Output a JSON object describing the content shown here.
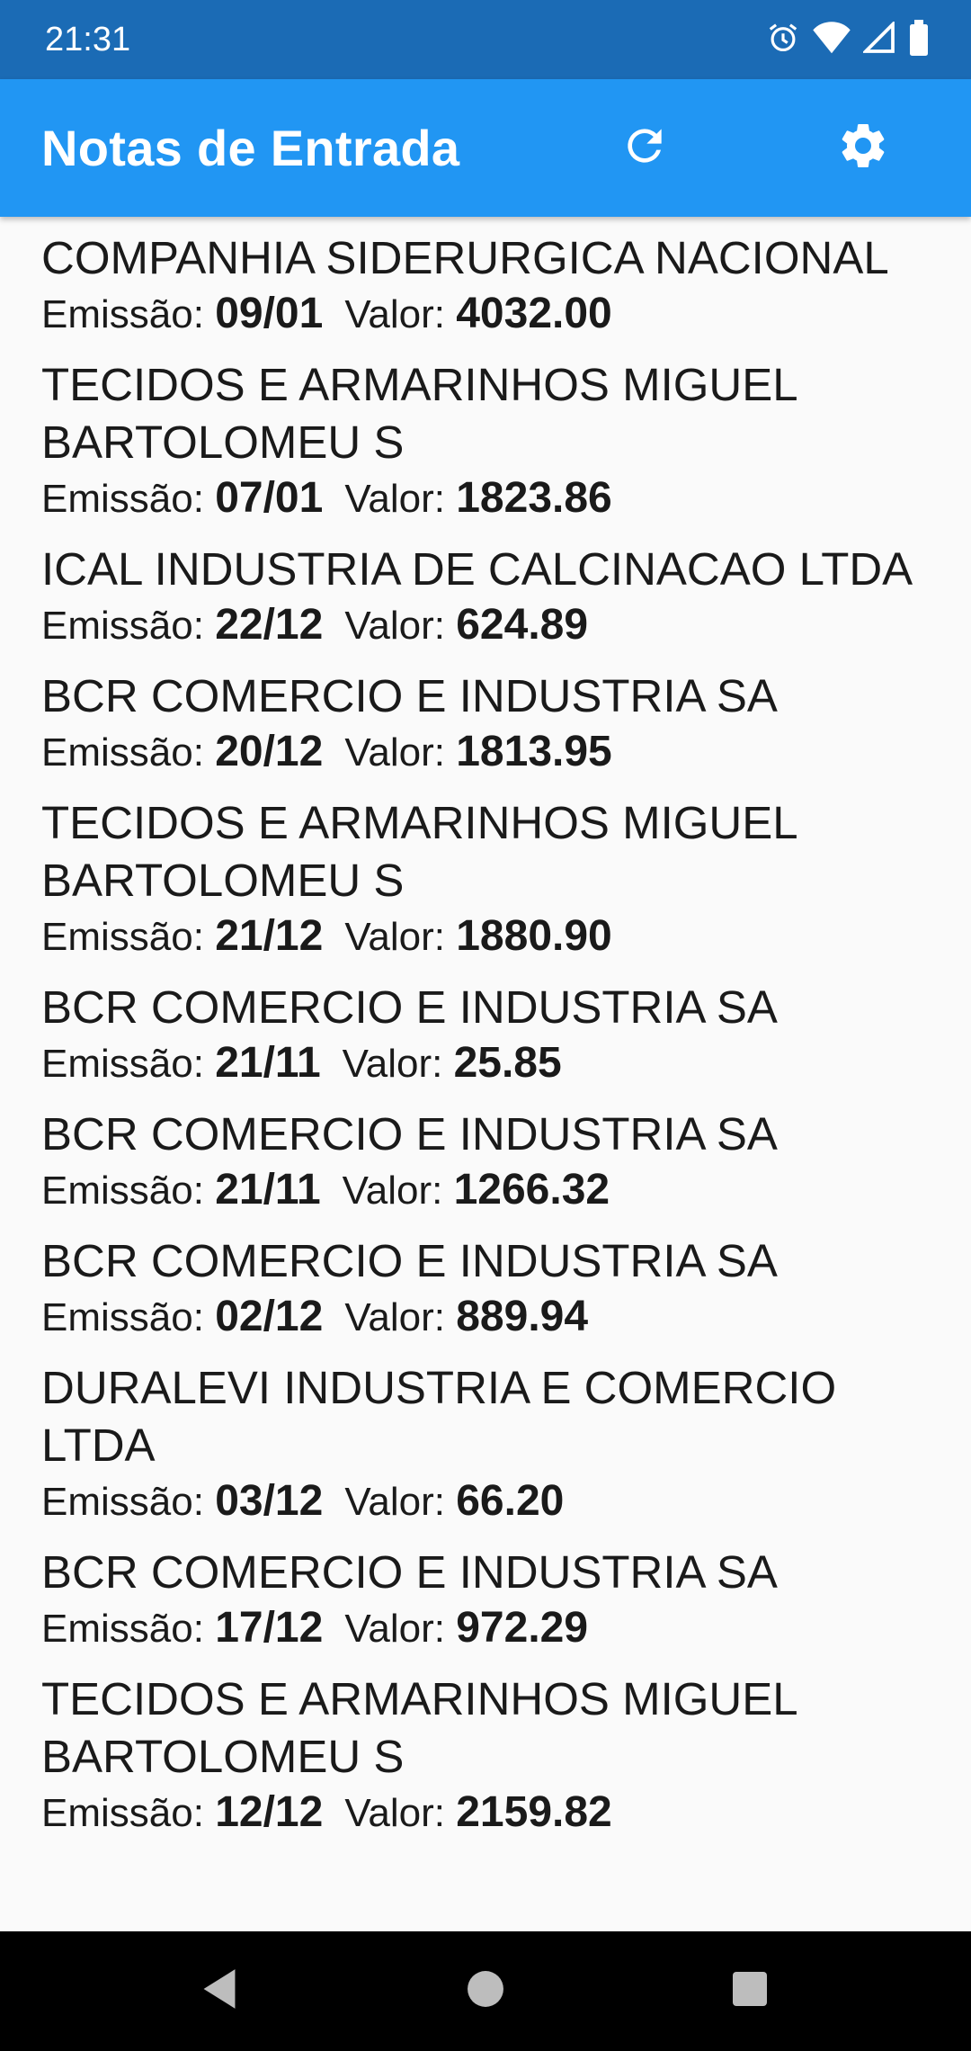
{
  "status_bar": {
    "time": "21:31"
  },
  "app_bar": {
    "title": "Notas de Entrada"
  },
  "labels": {
    "emissao": "Emissão:",
    "valor": "Valor:"
  },
  "notes": [
    {
      "name": "COMPANHIA SIDERURGICA NACIONAL",
      "emissao": "09/01",
      "valor": "4032.00"
    },
    {
      "name": "TECIDOS E ARMARINHOS MIGUEL BARTOLOMEU S",
      "emissao": "07/01",
      "valor": "1823.86"
    },
    {
      "name": "ICAL INDUSTRIA DE CALCINACAO LTDA",
      "emissao": "22/12",
      "valor": "624.89"
    },
    {
      "name": "BCR COMERCIO E INDUSTRIA SA",
      "emissao": "20/12",
      "valor": "1813.95"
    },
    {
      "name": "TECIDOS E ARMARINHOS MIGUEL BARTOLOMEU S",
      "emissao": "21/12",
      "valor": "1880.90"
    },
    {
      "name": "BCR COMERCIO E INDUSTRIA SA",
      "emissao": "21/11",
      "valor": "25.85"
    },
    {
      "name": "BCR COMERCIO E INDUSTRIA SA",
      "emissao": "21/11",
      "valor": "1266.32"
    },
    {
      "name": "BCR COMERCIO E INDUSTRIA SA",
      "emissao": "02/12",
      "valor": "889.94"
    },
    {
      "name": "DURALEVI INDUSTRIA E COMERCIO LTDA",
      "emissao": "03/12",
      "valor": "66.20"
    },
    {
      "name": "BCR COMERCIO E INDUSTRIA SA",
      "emissao": "17/12",
      "valor": "972.29"
    },
    {
      "name": "TECIDOS E ARMARINHOS MIGUEL BARTOLOMEU S",
      "emissao": "12/12",
      "valor": "2159.82"
    }
  ],
  "icons": {
    "app_bar": [
      "refresh-icon",
      "settings-gear-icon"
    ],
    "status": [
      "alarm-icon",
      "wifi-icon",
      "cell-signal-icon",
      "battery-icon"
    ],
    "nav": [
      "back-icon",
      "home-icon",
      "recents-icon"
    ]
  },
  "colors": {
    "status_bar": "#1b6bb5",
    "app_bar": "#2196f3",
    "background": "#fafafa",
    "nav_bar": "#000000"
  }
}
